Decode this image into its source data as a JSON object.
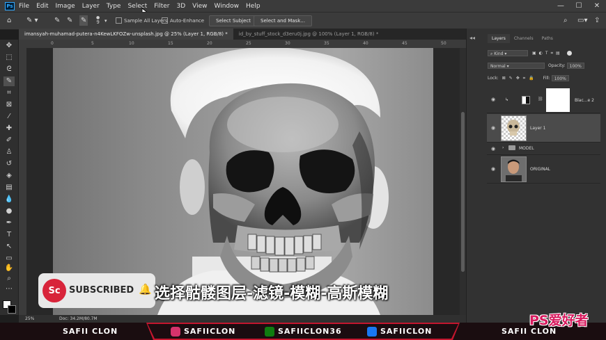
{
  "menu": [
    "File",
    "Edit",
    "Image",
    "Layer",
    "Type",
    "Select",
    "Filter",
    "3D",
    "View",
    "Window",
    "Help"
  ],
  "app_logo": "Ps",
  "options": {
    "brush_size": "9",
    "sample_all_layers": "Sample All Layers",
    "auto_enhance": "Auto-Enhance",
    "select_subject": "Select Subject",
    "select_and_mask": "Select and Mask..."
  },
  "tabs": [
    {
      "label": "imansyah-muhamad-putera-n4KewLKFOZw-unsplash.jpg @ 25% (Layer 1, RGB/8) *",
      "active": true
    },
    {
      "label": "id_by_stuff_stock_d3eru0j.jpg @ 100% (Layer 1, RGB/8) *",
      "active": false
    }
  ],
  "ruler_ticks": [
    "0",
    "5",
    "10",
    "15",
    "20",
    "25",
    "30",
    "35",
    "40",
    "45",
    "50"
  ],
  "status": {
    "zoom": "25%",
    "doc": "Doc: 34.2M/80.7M"
  },
  "panel": {
    "tabs": [
      "Layers",
      "Channels",
      "Paths"
    ],
    "kind": "Kind",
    "blend_mode": "Normal",
    "opacity_label": "Opacity:",
    "opacity_value": "100%",
    "lock_label": "Lock:",
    "fill_label": "Fill:",
    "fill_value": "100%",
    "layers": [
      {
        "name": "Blac...e 2",
        "type": "adjustment"
      },
      {
        "name": "Layer 1",
        "type": "skull",
        "selected": true
      },
      {
        "name": "MODEL",
        "type": "group"
      },
      {
        "name": "ORIGINAL",
        "type": "photo"
      }
    ]
  },
  "overlay": {
    "subscribed": "SUBSCRIBED",
    "sc_logo": "Sc",
    "caption": "选择骷髅图层-滤镜-模糊-高斯模糊"
  },
  "banner": {
    "left": "SAFII CLON",
    "instagram": "SAFIICLON",
    "xbox": "SAFIICLON36",
    "facebook": "SAFIICLON",
    "right": "SAFII CLON",
    "watermark": "PS爱好者"
  },
  "colors": {
    "accent": "#31a8ff",
    "banner_red": "#c4162e",
    "sc_red": "#d8243a"
  }
}
